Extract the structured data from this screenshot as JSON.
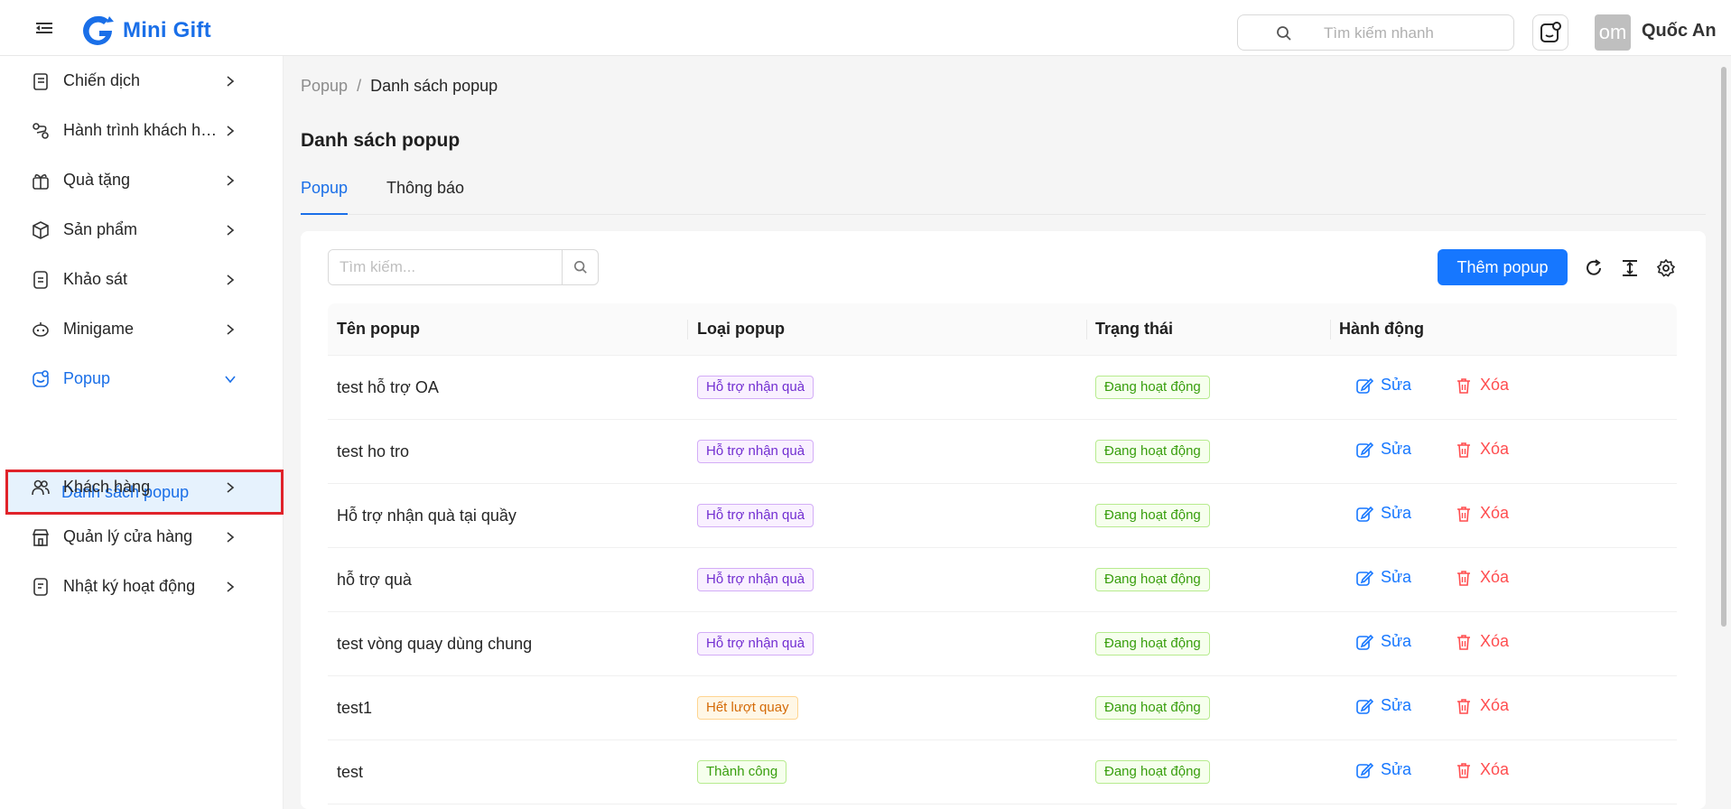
{
  "header": {
    "logo_text": "Mini Gift",
    "search_placeholder": "Tìm kiếm nhanh",
    "avatar_text": "om",
    "user_name": "Quốc An"
  },
  "sidebar": {
    "items": [
      {
        "label": "Chiến dịch",
        "icon": "campaign-icon"
      },
      {
        "label": "Hành trình khách hàng",
        "icon": "journey-icon"
      },
      {
        "label": "Quà tặng",
        "icon": "gift-icon"
      },
      {
        "label": "Sản phẩm",
        "icon": "box-icon"
      },
      {
        "label": "Khảo sát",
        "icon": "survey-icon"
      },
      {
        "label": "Minigame",
        "icon": "gamepad-icon"
      },
      {
        "label": "Popup",
        "icon": "popup-icon"
      },
      {
        "label": "Khách hàng",
        "icon": "users-icon"
      },
      {
        "label": "Quản lý cửa hàng",
        "icon": "store-icon"
      },
      {
        "label": "Nhật ký hoạt động",
        "icon": "log-icon"
      }
    ],
    "sub_item_label": "Danh sách popup"
  },
  "breadcrumb": {
    "root": "Popup",
    "separator": "/",
    "current": "Danh sách popup"
  },
  "page_title": "Danh sách popup",
  "tabs": [
    {
      "label": "Popup"
    },
    {
      "label": "Thông báo"
    }
  ],
  "toolbar": {
    "search_placeholder": "Tìm kiếm...",
    "add_label": "Thêm popup"
  },
  "table": {
    "columns": [
      "Tên popup",
      "Loại popup",
      "Trạng thái",
      "Hành động"
    ],
    "rows": [
      {
        "name": "test hỗ trợ OA",
        "type": "Hỗ trợ nhận quà",
        "type_color": "purple",
        "status": "Đang hoạt động"
      },
      {
        "name": "test ho tro",
        "type": "Hỗ trợ nhận quà",
        "type_color": "purple",
        "status": "Đang hoạt động"
      },
      {
        "name": "Hỗ trợ nhận quà tại quầy",
        "type": "Hỗ trợ nhận quà",
        "type_color": "purple",
        "status": "Đang hoạt động"
      },
      {
        "name": "hỗ trợ quà",
        "type": "Hỗ trợ nhận quà",
        "type_color": "purple",
        "status": "Đang hoạt động"
      },
      {
        "name": "test vòng quay dùng chung",
        "type": "Hỗ trợ nhận quà",
        "type_color": "purple",
        "status": "Đang hoạt động"
      },
      {
        "name": "test1",
        "type": "Hết lượt quay",
        "type_color": "orange",
        "status": "Đang hoạt động"
      },
      {
        "name": "test",
        "type": "Thành công",
        "type_color": "green",
        "status": "Đang hoạt động"
      }
    ],
    "edit_label": "Sửa",
    "delete_label": "Xóa"
  },
  "colors": {
    "primary": "#1677ff",
    "danger": "#ff4d4f",
    "highlight_border": "#e0232a"
  }
}
